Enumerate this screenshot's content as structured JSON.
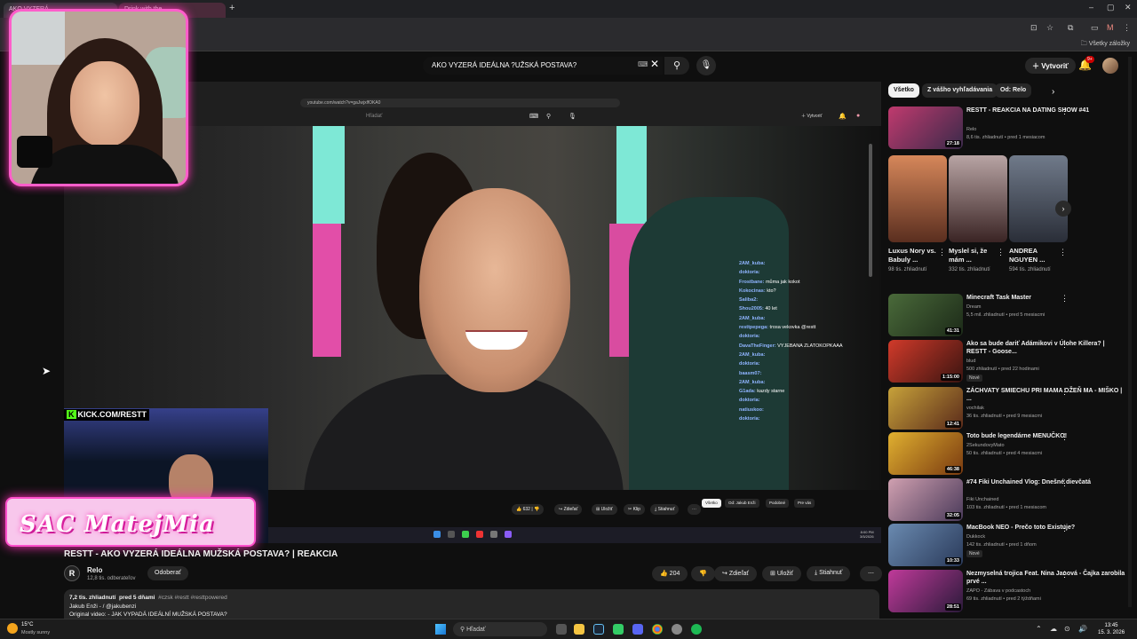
{
  "browser": {
    "tabs": [
      {
        "label": "Drink with the"
      },
      {
        "label": "AKO VYZERÁ"
      }
    ],
    "bookmarks_all": "Všetky záložky"
  },
  "header": {
    "search_value": "AKO VYZERÁ IDEÁLNA ?UŽSKÁ POSTAVA?",
    "create_label": "Vytvoriť",
    "notifications_badge": "9+"
  },
  "player": {
    "inner_url": "youtube.com/watch?v=gaJwjxlfOKA0",
    "inner_search": "Hľadať",
    "inner_create": "Vytvoriť",
    "chat": [
      {
        "user": "2AM_kuba:",
        "msg": ""
      },
      {
        "user": "doktoria:",
        "msg": ""
      },
      {
        "user": "Frostbane:",
        "msg": "můma jak kokot"
      },
      {
        "user": "Kokocinas:",
        "msg": "kto?"
      },
      {
        "user": "Saliba2:",
        "msg": ""
      },
      {
        "user": "Shou2005:",
        "msg": "40 let"
      },
      {
        "user": "2AM_kuba:",
        "msg": ""
      },
      {
        "user": "resttpepega:",
        "msg": "trosa vekovka @restt"
      },
      {
        "user": "doktoria:",
        "msg": ""
      },
      {
        "user": "DavaTheFinger:",
        "msg": "VYJEBANA ZLATOKOPKAAA"
      },
      {
        "user": "2AM_kuba:",
        "msg": ""
      },
      {
        "user": "doktoria:",
        "msg": ""
      },
      {
        "user": "baasm07:",
        "msg": ""
      },
      {
        "user": "2AM_kuba:",
        "msg": ""
      },
      {
        "user": "G1ada:",
        "msg": "kazdy starne"
      },
      {
        "user": "doktoria:",
        "msg": ""
      },
      {
        "user": "natiuskoo:",
        "msg": ""
      },
      {
        "user": "doktoria:",
        "msg": ""
      }
    ],
    "inner_actions": {
      "like": "632",
      "share": "Zdieľať",
      "save": "Uložiť",
      "clip": "Klip",
      "download": "Stiahnuť"
    },
    "inner_chips": [
      "Všetko",
      "Od: Jakub Enži",
      "Podobné",
      "Pre vás"
    ],
    "inner_time": "8:00 PM",
    "inner_date": "3/5/2026",
    "kick_label": "KICK.COM/RESTT",
    "overlay_name": "SAC MatejMia"
  },
  "video": {
    "title": "RESTT - AKO VYZERÁ IDEÁLNA MUŽSKÁ POSTAVA? | REAKCIA",
    "channel_name": "Relo",
    "channel_logo": "R",
    "subscribers": "12,8 tis. odberateľov",
    "subscribe_label": "Odoberať",
    "likes": "204",
    "share_label": "Zdieľať",
    "save_label": "Uložiť",
    "download_label": "Stiahnuť",
    "desc_views": "7,2 tis. zhliadnutí",
    "desc_date": "pred 5 dňami",
    "desc_tags": "#czsk #restt #resttpowered",
    "desc_line2": "Jakub Enži -  / @jakubenzi",
    "desc_line3": "Original video:  - JAK VYPADÁ IDEÁLNÍ MUŽSKÁ POSTAVA?"
  },
  "sidebar": {
    "chips": [
      "Všetko",
      "Z vášho vyhľadávania",
      "Od: Relo"
    ],
    "top_rec": {
      "title": "RESTT - REAKCIA NA DATING SHOW #41",
      "channel": "Relo",
      "meta": "8,6 tis. zhliadnutí • pred 1 mesiacom",
      "duration": "27:18"
    },
    "shorts": [
      {
        "title": "Luxus Nory vs. Babuly ...",
        "views": "98 tis. zhliadnutí"
      },
      {
        "title": "Myslel si, že mám ...",
        "views": "332 tis. zhliadnutí"
      },
      {
        "title": "ANDREA NGUYEN ...",
        "views": "594 tis. zhliadnutí"
      }
    ],
    "recs": [
      {
        "title": "Minecraft Task Master",
        "channel": "Dream",
        "meta": "5,5 mil. zhliadnutí • pred 5 mesiacmi",
        "duration": "41:31",
        "badge": ""
      },
      {
        "title": "Ako sa bude dariť Adámikovi v Úlohe Killera? | RESTT - Goose...",
        "channel": "blud",
        "meta": "500 zhliadnutí • pred 22 hodinami",
        "duration": "1:15:00",
        "badge": "Nové"
      },
      {
        "title": "ZÁCHVATY SMIECHU PRI MAMA OŽEŇ MA - MIŠKO | ...",
        "channel": "vochilak",
        "meta": "36 tis. zhliadnutí • pred 9 mesiacmi",
        "duration": "12:41",
        "badge": ""
      },
      {
        "title": "Toto bude legendárne MENUČKO!",
        "channel": "2SekundovyMato",
        "meta": "50 tis. zhliadnutí • pred 4 mesiacmi",
        "duration": "46:38",
        "badge": ""
      },
      {
        "title": "#74 Fiki Unchained Vlog: Dnešné dievčatá",
        "channel": "Fiki Unchained",
        "meta": "103 tis. zhliadnutí • pred 1 mesiacom",
        "duration": "32:05",
        "badge": ""
      },
      {
        "title": "MacBook NEO - Prečo toto Existuje?",
        "channel": "Dukkock",
        "meta": "142 tis. zhliadnutí • pred 1 dňom",
        "duration": "10:33",
        "badge": "Nové"
      },
      {
        "title": "Nezmyselná trojica Feat. Nina Janová - Čajka zarobila prvé ...",
        "channel": "ZAPO - Zábava v podcastoch",
        "meta": "69 tis. zhliadnutí • pred 2 týždňami",
        "duration": "28:51",
        "badge": ""
      }
    ]
  },
  "taskbar": {
    "temp": "15°C",
    "weather": "Mostly sunny",
    "search": "Hľadať",
    "time": "13:45",
    "date": "15. 3. 2026"
  }
}
